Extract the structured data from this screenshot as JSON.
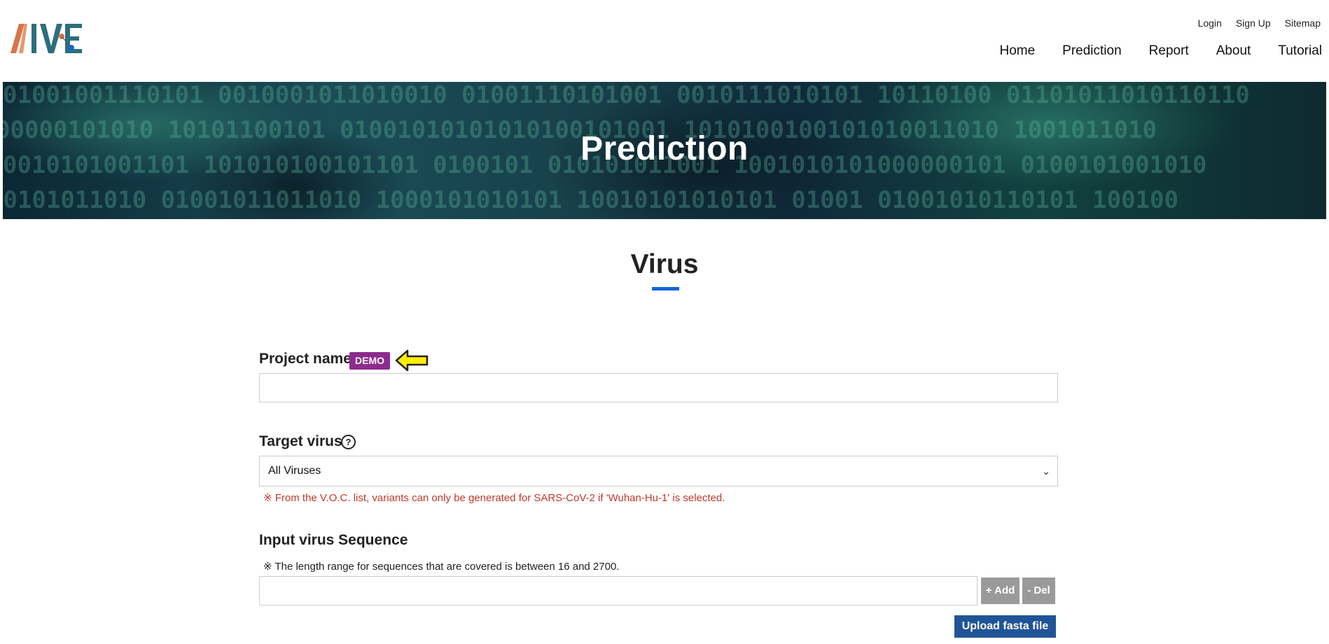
{
  "header": {
    "logo_text": "AIVE",
    "util_links": [
      "Login",
      "Sign Up",
      "Sitemap"
    ],
    "nav": [
      "Home",
      "Prediction",
      "Report",
      "About",
      "Tutorial"
    ]
  },
  "banner": {
    "title": "Prediction"
  },
  "section": {
    "title": "Virus"
  },
  "form": {
    "project_name_label": "Project name",
    "demo_badge": "DEMO",
    "project_name_value": "",
    "target_virus_label": "Target virus",
    "help_symbol": "?",
    "target_virus_selected": "All Viruses",
    "target_virus_note": "※ From the V.O.C. list, variants can only be generated for SARS-CoV-2 if 'Wuhan-Hu-1' is selected.",
    "sequence_label": "Input virus Sequence",
    "sequence_note": "※ The length range for sequences that are covered is between 16 and 2700.",
    "sequence_value": "",
    "add_button": "+ Add",
    "del_button": "- Del",
    "upload_button": "Upload fasta file"
  },
  "colors": {
    "accent_blue": "#1565d8",
    "demo_purple": "#8e2b8d",
    "upload_blue": "#1f5597",
    "note_red": "#c0392b",
    "gray_button": "#9a9a9a"
  }
}
